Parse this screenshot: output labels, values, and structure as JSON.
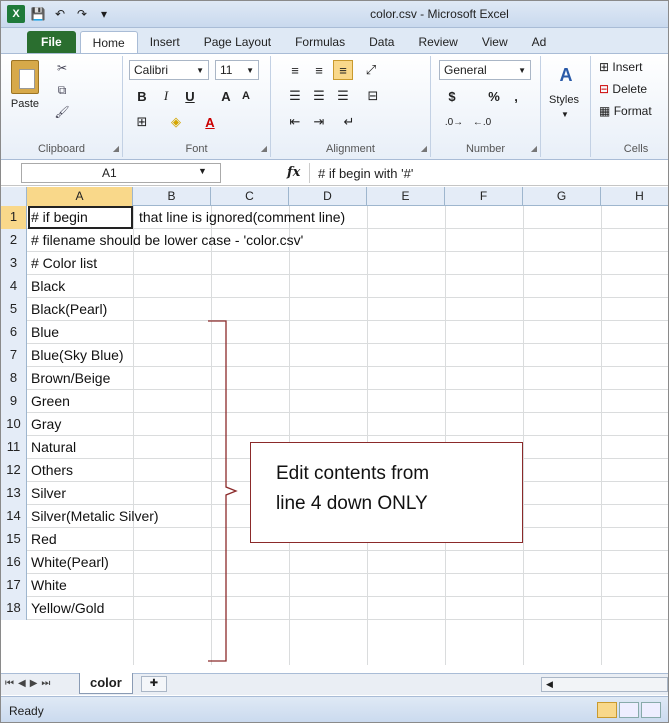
{
  "window": {
    "title": "color.csv  -  Microsoft Excel"
  },
  "tabs": [
    "File",
    "Home",
    "Insert",
    "Page Layout",
    "Formulas",
    "Data",
    "Review",
    "View",
    "Ad"
  ],
  "ribbon": {
    "clipboard": {
      "label": "Clipboard",
      "paste": "Paste"
    },
    "font": {
      "label": "Font",
      "name": "Calibri",
      "size": "11",
      "bold": "B",
      "italic": "I",
      "underline": "U",
      "grow": "A",
      "shrink": "A"
    },
    "alignment": {
      "label": "Alignment"
    },
    "number": {
      "label": "Number",
      "format": "General",
      "currency": "$",
      "percent": "%",
      "comma": ","
    },
    "styles": {
      "label": "Styles"
    },
    "cells": {
      "label": "Cells",
      "insert": "Insert",
      "delete": "Delete",
      "format": "Format"
    }
  },
  "formula_bar": {
    "cell_ref": "A1",
    "fx": "fx",
    "content": "# if begin with '#'"
  },
  "columns": [
    "A",
    "B",
    "C",
    "D",
    "E",
    "F",
    "G",
    "H"
  ],
  "rows": [
    {
      "n": "1",
      "a": "# if begin ",
      "rest": "that line is ignored(comment line)"
    },
    {
      "n": "2",
      "a": "# filename should be lower case - 'color.csv'",
      "rest": ""
    },
    {
      "n": "3",
      "a": "# Color list",
      "rest": ""
    },
    {
      "n": "4",
      "a": "Black",
      "rest": ""
    },
    {
      "n": "5",
      "a": "Black(Pearl)",
      "rest": ""
    },
    {
      "n": "6",
      "a": "Blue",
      "rest": ""
    },
    {
      "n": "7",
      "a": "Blue(Sky Blue)",
      "rest": ""
    },
    {
      "n": "8",
      "a": "Brown/Beige",
      "rest": ""
    },
    {
      "n": "9",
      "a": "Green",
      "rest": ""
    },
    {
      "n": "10",
      "a": "Gray",
      "rest": ""
    },
    {
      "n": "11",
      "a": "Natural",
      "rest": ""
    },
    {
      "n": "12",
      "a": "Others",
      "rest": ""
    },
    {
      "n": "13",
      "a": "Silver",
      "rest": ""
    },
    {
      "n": "14",
      "a": "Silver(Metalic Silver)",
      "rest": ""
    },
    {
      "n": "15",
      "a": "Red",
      "rest": ""
    },
    {
      "n": "16",
      "a": "White(Pearl)",
      "rest": ""
    },
    {
      "n": "17",
      "a": "White",
      "rest": ""
    },
    {
      "n": "18",
      "a": "Yellow/Gold",
      "rest": ""
    }
  ],
  "sheet_tab": "color",
  "status": "Ready",
  "annotation": {
    "line1": "Edit contents from",
    "line2": "line 4 down ONLY"
  }
}
